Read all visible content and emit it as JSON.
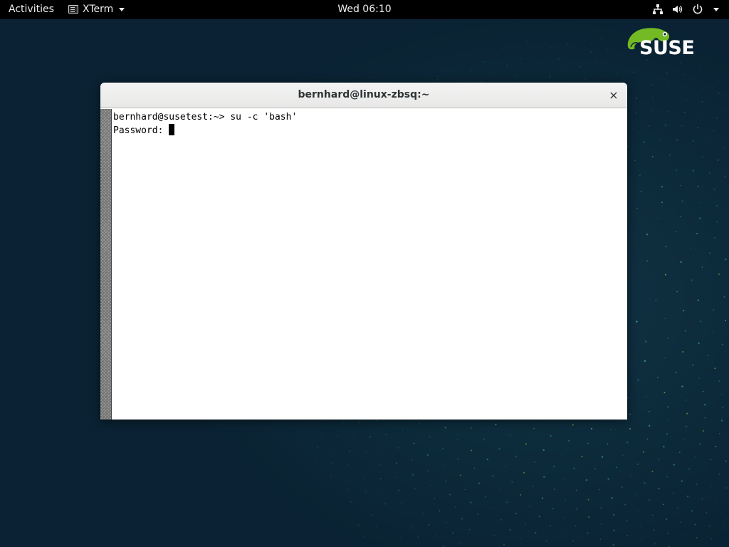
{
  "topbar": {
    "activities_label": "Activities",
    "app_menu_label": "XTerm",
    "clock": "Wed 06:10",
    "icons": [
      "network-icon",
      "volume-icon",
      "power-icon",
      "system-menu-chevron-icon"
    ]
  },
  "desktop": {
    "logo_text": "SUSE",
    "logo_color": "#73ba25",
    "background_color": "#0b2434"
  },
  "window": {
    "title": "bernhard@linux-zbsq:~",
    "close_label": "×",
    "terminal": {
      "lines": [
        "bernhard@susetest:~> su -c 'bash'",
        "Password: "
      ]
    }
  }
}
